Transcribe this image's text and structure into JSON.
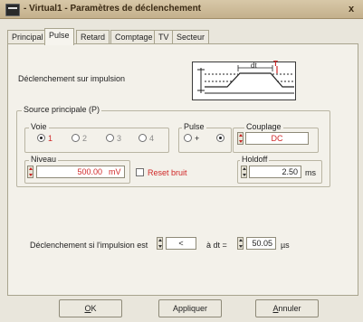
{
  "window": {
    "title": "- Virtual1 - Paramètres de déclenchement",
    "close_glyph": "x"
  },
  "tabs": [
    {
      "label": "Principal",
      "active": false
    },
    {
      "label": "Pulse",
      "active": true
    },
    {
      "label": "Retard",
      "active": false
    },
    {
      "label": "Comptage",
      "active": false
    },
    {
      "label": "TV",
      "active": false
    },
    {
      "label": "Secteur",
      "active": false
    }
  ],
  "trigger": {
    "label": "Déclenchement sur impulsion",
    "diagram": {
      "dt_label": "dt",
      "marker": "T"
    }
  },
  "source": {
    "group_title": "Source principale (P)",
    "voie": {
      "title": "Voie",
      "options": [
        {
          "label": "1",
          "checked": true
        },
        {
          "label": "2",
          "checked": false
        },
        {
          "label": "3",
          "checked": false
        },
        {
          "label": "4",
          "checked": false
        }
      ]
    },
    "pulse": {
      "title": "Pulse",
      "options": [
        {
          "label": "+",
          "checked": false
        },
        {
          "label": "",
          "checked": true
        }
      ]
    },
    "couplage": {
      "title": "Couplage",
      "value": "DC"
    },
    "niveau": {
      "title": "Niveau",
      "value": "500.00",
      "unit": "mV"
    },
    "reset_bruit": {
      "label": "Reset bruit",
      "checked": false
    },
    "holdoff": {
      "title": "Holdoff",
      "value": "2.50",
      "unit": "ms"
    }
  },
  "condition": {
    "label": "Déclenchement si l'impulsion est",
    "operator": "<",
    "dt_label": "à dt =",
    "value": "50.05",
    "unit": "µs"
  },
  "buttons": {
    "ok": {
      "label": "OK",
      "underline": "O",
      "rest": "K"
    },
    "apply": {
      "label": "Appliquer"
    },
    "cancel": {
      "label": "Annuler",
      "underline": "A",
      "rest": "nnuler"
    }
  },
  "colors": {
    "accent_red": "#d02828"
  }
}
